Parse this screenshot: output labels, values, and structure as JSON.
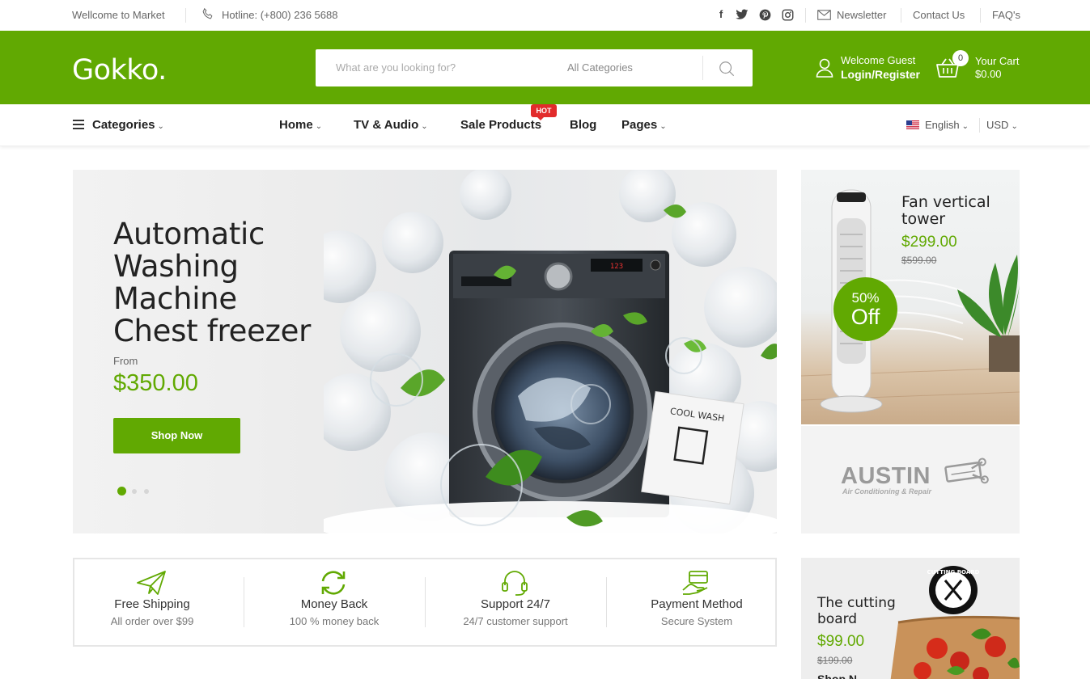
{
  "topbar": {
    "welcome": "Wellcome to Market",
    "hotline": "Hotline: (+800) 236 5688",
    "social_icons": [
      "facebook-icon",
      "twitter-icon",
      "pinterest-icon",
      "instagram-icon"
    ],
    "newsletter": "Newsletter",
    "contact": "Contact Us",
    "faq": "FAQ's"
  },
  "header": {
    "logo": "Gokko.",
    "search_placeholder": "What are you looking for?",
    "search_category": "All Categories",
    "welcome_guest": "Welcome Guest",
    "login_register": "Login/Register",
    "cart_count": "0",
    "cart_label": "Your Cart",
    "cart_total": "$0.00",
    "brand_color": "#61a902"
  },
  "nav": {
    "categories": "Categories",
    "items": [
      {
        "label": "Home",
        "has_dropdown": true
      },
      {
        "label": "TV & Audio",
        "has_dropdown": true
      },
      {
        "label": "Sale Products",
        "has_dropdown": false
      },
      {
        "label": "Blog",
        "has_dropdown": false
      },
      {
        "label": "Pages",
        "has_dropdown": true
      }
    ],
    "hot_badge": "HOT",
    "language": "English",
    "currency": "USD"
  },
  "hero": {
    "title_lines": [
      "Automatic",
      "Washing",
      "Machine",
      "Chest freezer"
    ],
    "from_label": "From",
    "price": "$350.00",
    "button": "Shop Now",
    "slide_count": 3,
    "active_slide": 1,
    "packet_text": "COOL WASH",
    "panel_digits": "123"
  },
  "fan_banner": {
    "title_line1": "Fan vertical",
    "title_line2": "tower",
    "price": "$299.00",
    "old_price": "$599.00",
    "badge_percent": "50%",
    "badge_off": "Off"
  },
  "austin_banner": {
    "logo": "AUSTIN",
    "subtitle": "Air Conditioning & Repair"
  },
  "features": [
    {
      "icon": "paper-plane-icon",
      "title": "Free Shipping",
      "subtitle": "All order over $99"
    },
    {
      "icon": "refresh-icon",
      "title": "Money Back",
      "subtitle": "100 % money back"
    },
    {
      "icon": "headset-icon",
      "title": "Support 24/7",
      "subtitle": "24/7 customer support"
    },
    {
      "icon": "payment-card-icon",
      "title": "Payment Method",
      "subtitle": "Secure System"
    }
  ],
  "board_banner": {
    "title_line1": "The cutting",
    "title_line2": "board",
    "price": "$99.00",
    "old_price": "$199.00",
    "shop_partial": "Shop N",
    "seal_text": "CUTTING BOARD"
  }
}
